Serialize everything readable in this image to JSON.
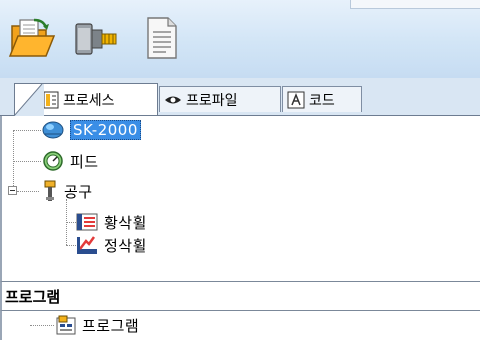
{
  "toolbar": {
    "buttons": [
      {
        "name": "open-folder",
        "icon": "folder-open-icon"
      },
      {
        "name": "machine",
        "icon": "spindle-icon"
      },
      {
        "name": "document",
        "icon": "document-icon"
      }
    ]
  },
  "tabs": [
    {
      "label": "프로세스",
      "icon": "process-icon",
      "active": true
    },
    {
      "label": "프로파일",
      "icon": "eye-icon",
      "active": false
    },
    {
      "label": "코드",
      "icon": "code-icon",
      "active": false
    }
  ],
  "tree": {
    "machine": "SK-2000",
    "feed": "피드",
    "tool": "공구",
    "roughing": "황삭휠",
    "finishing": "정삭휠"
  },
  "program_section": {
    "title": "프로그램",
    "item": "프로그램"
  },
  "colors": {
    "selection": "#3a8ee6",
    "toolbar": "#d2e5f6"
  }
}
